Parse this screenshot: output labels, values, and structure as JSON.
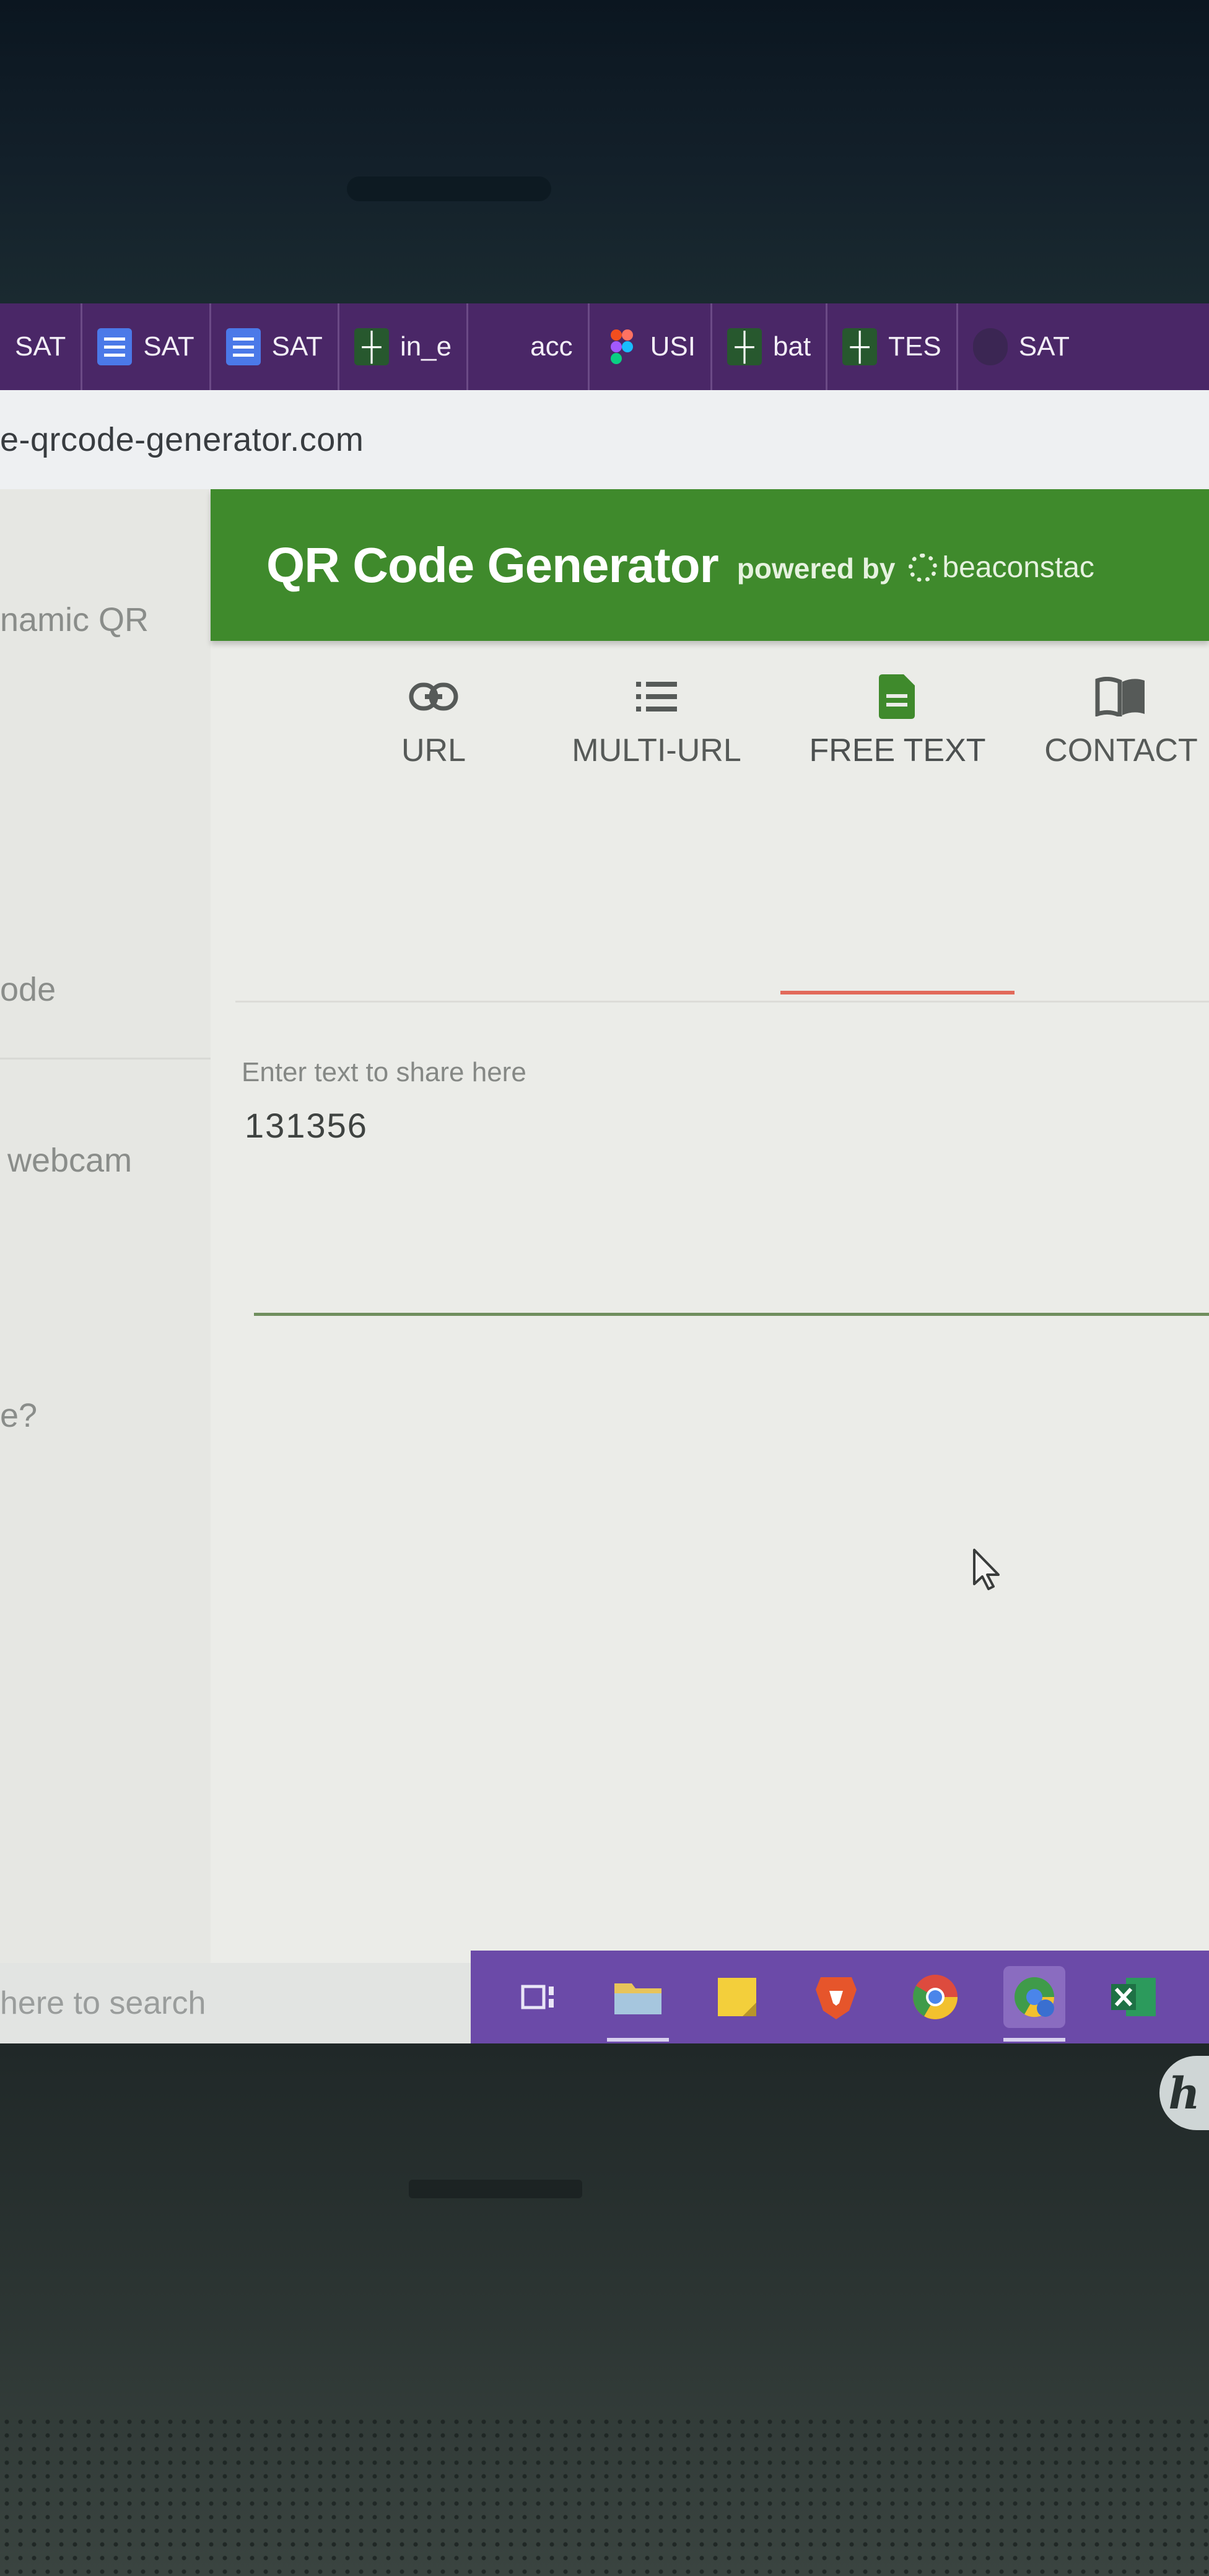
{
  "bookmarks": [
    {
      "label": "SAT",
      "icon": "shield-icon"
    },
    {
      "label": "SAT",
      "icon": "google-docs-icon"
    },
    {
      "label": "SAT",
      "icon": "google-docs-icon"
    },
    {
      "label": "in_e",
      "icon": "tree-icon"
    },
    {
      "label": "acc",
      "icon": "blank-icon"
    },
    {
      "label": "USI",
      "icon": "figma-icon"
    },
    {
      "label": "bat",
      "icon": "tree-icon"
    },
    {
      "label": "TES",
      "icon": "tree-icon"
    },
    {
      "label": "SAT",
      "icon": "shield-icon"
    }
  ],
  "address_bar": {
    "url": "e-qrcode-generator.com"
  },
  "left_panel": {
    "items": [
      "namic QR",
      "ode",
      "webcam",
      "e?"
    ],
    "search_placeholder": "here to search"
  },
  "header": {
    "title": "QR Code Generator",
    "powered_by": "powered by",
    "brand": "beaconstac"
  },
  "tabs": [
    {
      "label": "URL",
      "icon": "link-icon",
      "active": false
    },
    {
      "label": "MULTI-URL",
      "icon": "list-icon",
      "active": false
    },
    {
      "label": "FREE TEXT",
      "icon": "document-icon",
      "active": true
    },
    {
      "label": "CONTACT",
      "icon": "book-icon",
      "active": false
    }
  ],
  "free_text": {
    "label": "Enter text to share here",
    "value": "131356"
  },
  "colors": {
    "header_green": "#3f8a2c",
    "active_tab_indicator": "#e26a5a",
    "bookmarks_bar": "#4a2767",
    "taskbar": "#6b4aa8"
  },
  "taskbar": {
    "icons": [
      "task-view-icon",
      "file-explorer-icon",
      "sticky-notes-icon",
      "brave-browser-icon",
      "chrome-icon",
      "chrome-profile-icon",
      "excel-icon"
    ]
  }
}
